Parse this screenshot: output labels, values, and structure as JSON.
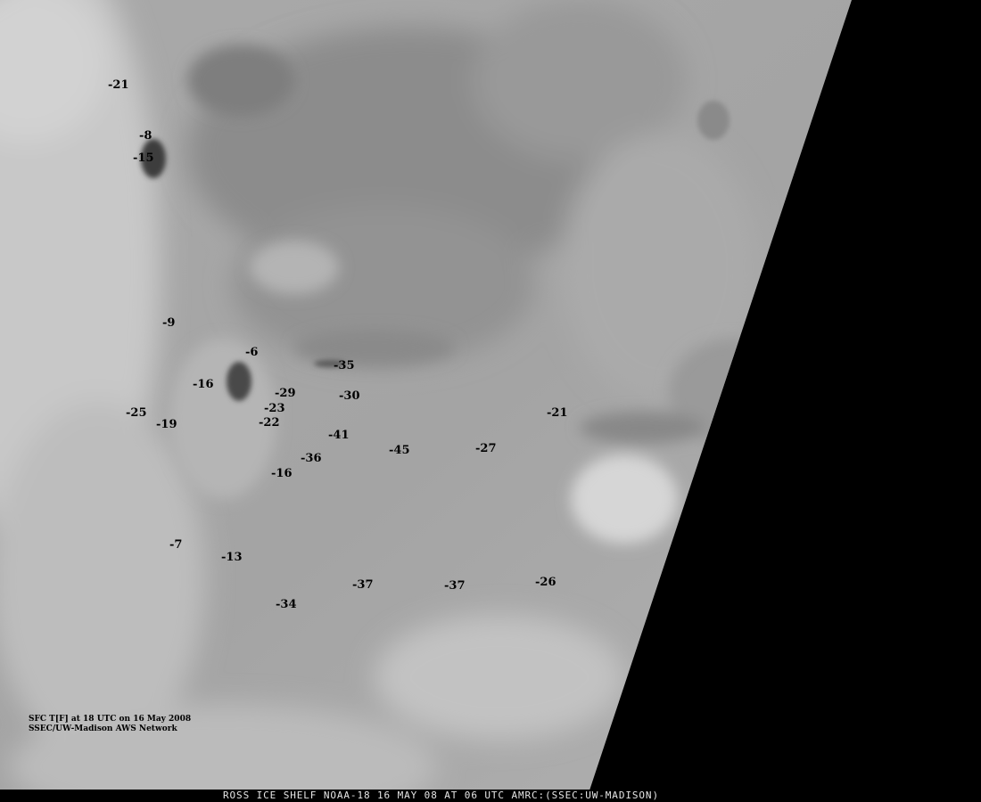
{
  "footer": {
    "caption": "ROSS ICE SHELF NOAA-18 16 MAY 08 AT 06 UTC AMRC:(SSEC:UW-MADISON)"
  },
  "legend": {
    "line1": "SFC T[F] at 18 UTC on 16 May 2008",
    "line2": "SSEC/UW-Madison AWS Network"
  },
  "observations": [
    "-21",
    "-8",
    "-15",
    "-9",
    "-6",
    "-35",
    "-16",
    "-29",
    "-30",
    "-23",
    "-25",
    "-19",
    "-22",
    "-21",
    "-41",
    "-45",
    "-27",
    "-36",
    "-16",
    "-7",
    "-13",
    "-37",
    "-37",
    "-26",
    "-34"
  ],
  "colors": {
    "background": "#000000",
    "label": "#000000",
    "footer_text": "#e6e6e6"
  }
}
